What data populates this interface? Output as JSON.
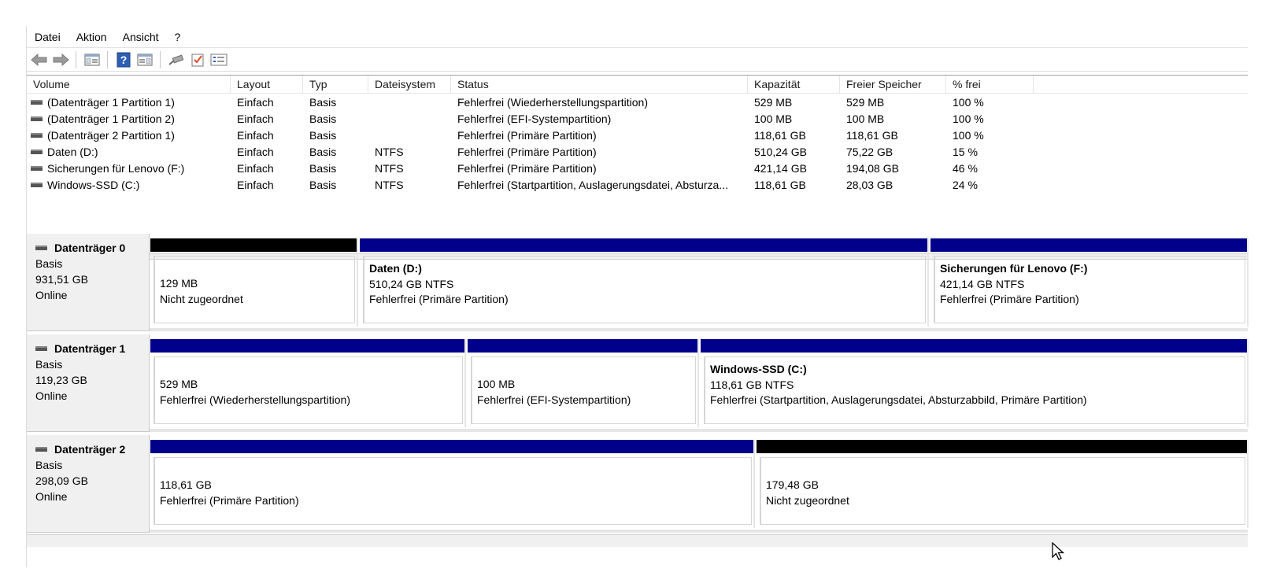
{
  "menu": [
    "Datei",
    "Aktion",
    "Ansicht",
    "?"
  ],
  "toolbar": {
    "buttons": [
      "back-arrow-icon",
      "forward-arrow-icon",
      "show-hide-console-tree-icon",
      "help-icon",
      "show-action-pane-icon",
      "connect-icon",
      "checklist-icon",
      "properties-icon"
    ]
  },
  "volume_list": {
    "columns": [
      "Volume",
      "Layout",
      "Typ",
      "Dateisystem",
      "Status",
      "Kapazität",
      "Freier Speicher",
      "% frei"
    ],
    "rows": [
      {
        "volume": "(Datenträger 1 Partition 1)",
        "layout": "Einfach",
        "typ": "Basis",
        "fs": "",
        "status": "Fehlerfrei (Wiederherstellungspartition)",
        "kap": "529 MB",
        "frei": "529 MB",
        "pct": "100 %"
      },
      {
        "volume": "(Datenträger 1 Partition 2)",
        "layout": "Einfach",
        "typ": "Basis",
        "fs": "",
        "status": "Fehlerfrei (EFI-Systempartition)",
        "kap": "100 MB",
        "frei": "100 MB",
        "pct": "100 %"
      },
      {
        "volume": "(Datenträger 2 Partition 1)",
        "layout": "Einfach",
        "typ": "Basis",
        "fs": "",
        "status": "Fehlerfrei (Primäre Partition)",
        "kap": "118,61 GB",
        "frei": "118,61 GB",
        "pct": "100 %"
      },
      {
        "volume": "Daten (D:)",
        "layout": "Einfach",
        "typ": "Basis",
        "fs": "NTFS",
        "status": "Fehlerfrei (Primäre Partition)",
        "kap": "510,24 GB",
        "frei": "75,22 GB",
        "pct": "15 %"
      },
      {
        "volume": "Sicherungen für Lenovo (F:)",
        "layout": "Einfach",
        "typ": "Basis",
        "fs": "NTFS",
        "status": "Fehlerfrei (Primäre Partition)",
        "kap": "421,14 GB",
        "frei": "194,08 GB",
        "pct": "46 %"
      },
      {
        "volume": "Windows-SSD (C:)",
        "layout": "Einfach",
        "typ": "Basis",
        "fs": "NTFS",
        "status": "Fehlerfrei (Startpartition, Auslagerungsdatei, Absturza...",
        "kap": "118,61 GB",
        "frei": "28,03 GB",
        "pct": "24 %"
      }
    ]
  },
  "disks": [
    {
      "name": "Datenträger 0",
      "type": "Basis",
      "size": "931,51 GB",
      "state": "Online",
      "partitions": [
        {
          "title": "",
          "line1": "129 MB",
          "line2": "Nicht zugeordnet",
          "color": "#000000"
        },
        {
          "title": "Daten  (D:)",
          "line1": "510,24 GB NTFS",
          "line2": "Fehlerfrei (Primäre Partition)",
          "color": "#00008b"
        },
        {
          "title": "Sicherungen für Lenovo  (F:)",
          "line1": "421,14 GB NTFS",
          "line2": "Fehlerfrei (Primäre Partition)",
          "color": "#00008b"
        }
      ]
    },
    {
      "name": "Datenträger 1",
      "type": "Basis",
      "size": "119,23 GB",
      "state": "Online",
      "partitions": [
        {
          "title": "",
          "line1": "529 MB",
          "line2": "Fehlerfrei (Wiederherstellungspartition)",
          "color": "#00008b"
        },
        {
          "title": "",
          "line1": "100 MB",
          "line2": "Fehlerfrei (EFI-Systempartition)",
          "color": "#00008b"
        },
        {
          "title": "Windows-SSD  (C:)",
          "line1": "118,61 GB NTFS",
          "line2": "Fehlerfrei (Startpartition, Auslagerungsdatei, Absturzabbild, Primäre Partition)",
          "color": "#00008b"
        }
      ]
    },
    {
      "name": "Datenträger 2",
      "type": "Basis",
      "size": "298,09 GB",
      "state": "Online",
      "partitions": [
        {
          "title": "",
          "line1": "118,61 GB",
          "line2": "Fehlerfrei (Primäre Partition)",
          "color": "#00008b"
        },
        {
          "title": "",
          "line1": "179,48 GB",
          "line2": "Nicht zugeordnet",
          "color": "#000000"
        }
      ]
    }
  ]
}
